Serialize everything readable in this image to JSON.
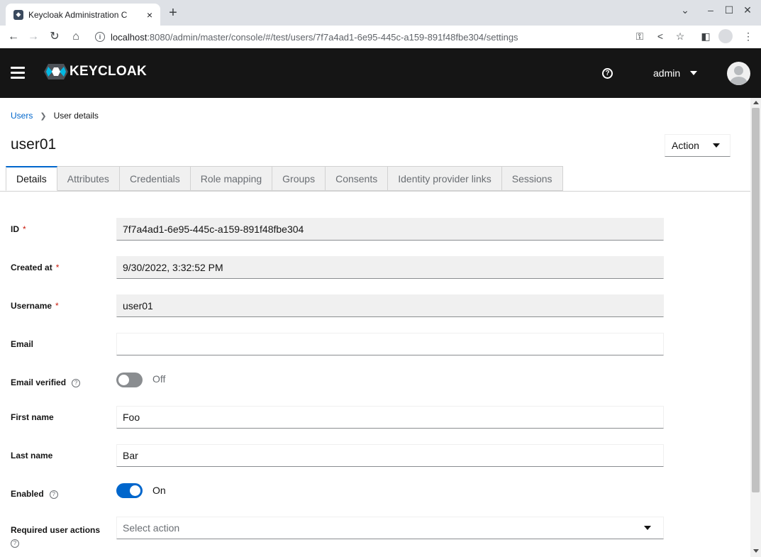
{
  "browser": {
    "tab_title": "Keycloak Administration C",
    "tab_close": "×",
    "new_tab": "+",
    "url_host": "localhost",
    "url_rest": ":8080/admin/master/console/#/test/users/7f7a4ad1-6e95-445c-a159-891f48fbe304/settings",
    "icons": [
      "back-arrow-icon",
      "forward-arrow-icon",
      "reload-icon",
      "home-icon",
      "site-info-icon",
      "key-icon",
      "share-icon",
      "bookmark-star-icon",
      "side-panel-icon",
      "profile-icon",
      "kebab-menu-icon",
      "chevron-down-icon",
      "minimize-icon",
      "maximize-icon",
      "close-icon"
    ]
  },
  "header": {
    "logo_text": "KEYCLOAK",
    "user": "admin",
    "bg_color": "#151515"
  },
  "breadcrumb": {
    "parent": "Users",
    "current": "User details"
  },
  "page_title": "user01",
  "action_label": "Action",
  "tabs": [
    {
      "label": "Details",
      "active": true
    },
    {
      "label": "Attributes",
      "active": false
    },
    {
      "label": "Credentials",
      "active": false
    },
    {
      "label": "Role mapping",
      "active": false
    },
    {
      "label": "Groups",
      "active": false
    },
    {
      "label": "Consents",
      "active": false
    },
    {
      "label": "Identity provider links",
      "active": false
    },
    {
      "label": "Sessions",
      "active": false
    }
  ],
  "form": {
    "id": {
      "label": "ID",
      "required": "*",
      "value": "7f7a4ad1-6e95-445c-a159-891f48fbe304"
    },
    "created_at": {
      "label": "Created at",
      "required": "*",
      "value": "9/30/2022, 3:32:52 PM"
    },
    "username": {
      "label": "Username",
      "required": "*",
      "value": "user01"
    },
    "email": {
      "label": "Email",
      "value": ""
    },
    "email_verified": {
      "label": "Email verified",
      "state": "Off"
    },
    "first_name": {
      "label": "First name",
      "value": "Foo"
    },
    "last_name": {
      "label": "Last name",
      "value": "Bar"
    },
    "enabled": {
      "label": "Enabled",
      "state": "On"
    },
    "required_actions": {
      "label": "Required user actions",
      "placeholder": "Select action"
    }
  },
  "colors": {
    "accent": "#0066cc",
    "required": "#c9190b"
  }
}
